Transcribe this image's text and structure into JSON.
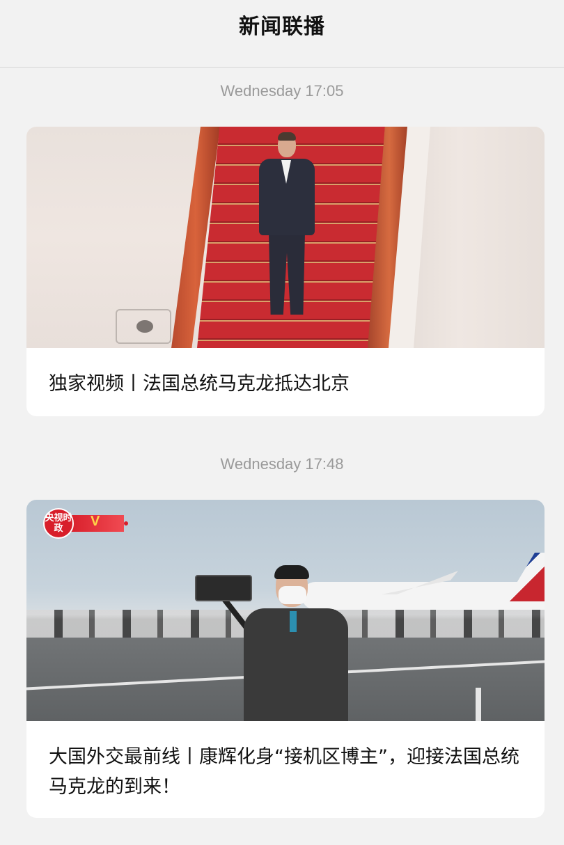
{
  "header": {
    "title": "新闻联播"
  },
  "feed": [
    {
      "timestamp": "Wednesday 17:05",
      "title": "独家视频丨法国总统马克龙抵达北京"
    },
    {
      "timestamp": "Wednesday 17:48",
      "title": "大国外交最前线丨康辉化身“接机区博主”，迎接法国总统马克龙的到来！",
      "badge": {
        "text": "央视时政"
      }
    }
  ]
}
